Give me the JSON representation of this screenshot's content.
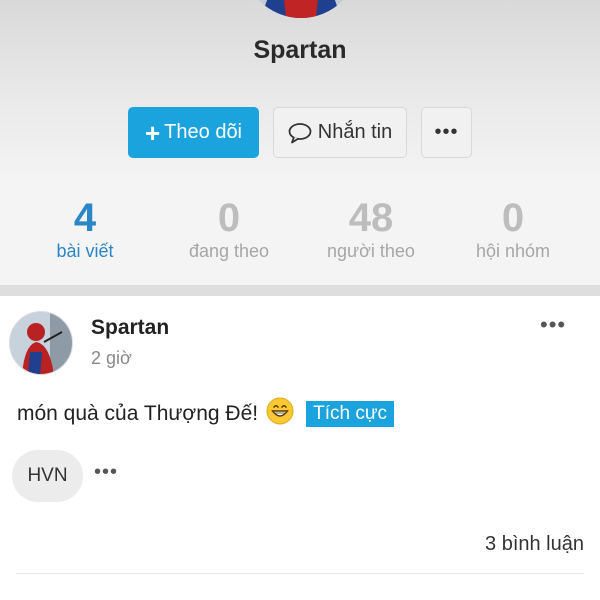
{
  "profile": {
    "name": "Spartan",
    "follow_label": "Theo dõi",
    "follow_icon": "plus-icon",
    "message_label": "Nhắn tin",
    "message_icon": "chat-bubble-icon",
    "more_label": "•••"
  },
  "stats": [
    {
      "value": "4",
      "label": "bài viết",
      "active": true
    },
    {
      "value": "0",
      "label": "đang theo",
      "active": false
    },
    {
      "value": "48",
      "label": "người theo",
      "active": false
    },
    {
      "value": "0",
      "label": "hội nhóm",
      "active": false
    }
  ],
  "post": {
    "author": "Spartan",
    "time": "2 giờ",
    "more_label": "•••",
    "text": "món quà của Thượng Đế!",
    "emoji_icon": "grinning-face-icon",
    "sentiment_tag": "Tích cực",
    "topic_tag": "HVN",
    "tag_more_label": "•••",
    "comments": "3 bình luận"
  },
  "colors": {
    "accent": "#1aa3dd",
    "stat_active": "#2b86c5",
    "stat_inactive": "#bdbdbd"
  }
}
